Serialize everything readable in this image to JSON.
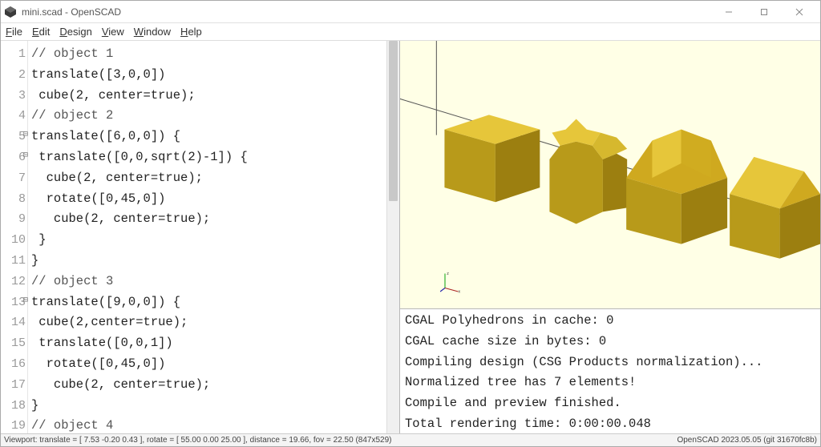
{
  "window": {
    "title": "mini.scad - OpenSCAD"
  },
  "menu": {
    "file": "File",
    "edit": "Edit",
    "design": "Design",
    "view": "View",
    "window": "Window",
    "help": "Help"
  },
  "code_lines": {
    "l1": "// object 1",
    "l2": "translate([3,0,0])",
    "l3": " cube(2, center=true);",
    "l4": "// object 2",
    "l5": "translate([6,0,0]) {",
    "l6": " translate([0,0,sqrt(2)-1]) {",
    "l7": "  cube(2, center=true);",
    "l8": "  rotate([0,45,0])",
    "l9": "   cube(2, center=true);",
    "l10": " }",
    "l11": "}",
    "l12": "// object 3",
    "l13": "translate([9,0,0]) {",
    "l14": " cube(2,center=true);",
    "l15": " translate([0,0,1])",
    "l16": "  rotate([0,45,0])",
    "l17": "   cube(2, center=true);",
    "l18": "}",
    "l19": "// object 4"
  },
  "line_numbers": {
    "n1": "1",
    "n2": "2",
    "n3": "3",
    "n4": "4",
    "n5": "5",
    "n6": "6",
    "n7": "7",
    "n8": "8",
    "n9": "9",
    "n10": "10",
    "n11": "11",
    "n12": "12",
    "n13": "13",
    "n14": "14",
    "n15": "15",
    "n16": "16",
    "n17": "17",
    "n18": "18",
    "n19": "19"
  },
  "axes": {
    "x": "x",
    "z": "z"
  },
  "console_lines": {
    "c1": "CGAL Polyhedrons in cache: 0",
    "c2": "CGAL cache size in bytes: 0",
    "c3": "Compiling design (CSG Products normalization)...",
    "c4": "Normalized tree has 7 elements!",
    "c5": "Compile and preview finished.",
    "c6": "Total rendering time: 0:00:00.048"
  },
  "status": {
    "left": "Viewport: translate = [ 7.53 -0.20 0.43 ], rotate = [ 55.00 0.00 25.00 ], distance = 19.66, fov = 22.50 (847x529)",
    "right": "OpenSCAD 2023.05.05 (git 31670fc8b)"
  }
}
